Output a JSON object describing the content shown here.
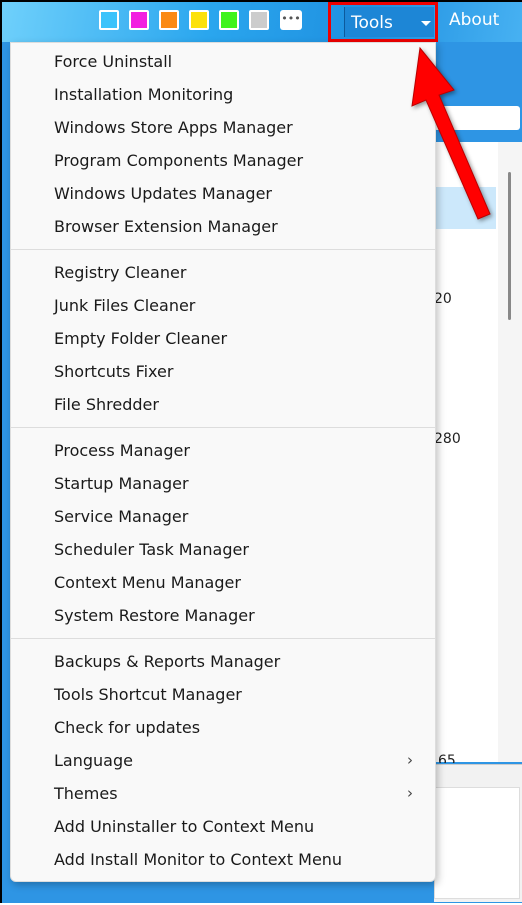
{
  "toolbar": {
    "swatches": [
      "#3cc3fb",
      "#f21fe0",
      "#fb8a14",
      "#fce10b",
      "#3ff31d",
      "#cccccc"
    ],
    "more_label": "•••",
    "tools_label": "Tools",
    "about_label": "About"
  },
  "background": {
    "fragments": [
      "20",
      "280",
      "65"
    ]
  },
  "menu": {
    "groups": [
      [
        "Force Uninstall",
        "Installation Monitoring",
        "Windows Store Apps Manager",
        "Program Components Manager",
        "Windows Updates Manager",
        "Browser Extension Manager"
      ],
      [
        "Registry Cleaner",
        "Junk Files Cleaner",
        "Empty Folder Cleaner",
        "Shortcuts Fixer",
        "File Shredder"
      ],
      [
        "Process Manager",
        "Startup Manager",
        "Service Manager",
        "Scheduler Task Manager",
        "Context Menu Manager",
        "System Restore Manager"
      ],
      [
        "Backups & Reports Manager",
        "Tools Shortcut Manager",
        "Check for updates",
        "Language",
        "Themes",
        "Add Uninstaller to Context Menu",
        "Add Install Monitor to Context Menu"
      ]
    ],
    "submenu_items": [
      "Language",
      "Themes"
    ]
  },
  "annotation": {
    "highlight_color": "#e00000",
    "arrow_color": "#ff0000"
  }
}
